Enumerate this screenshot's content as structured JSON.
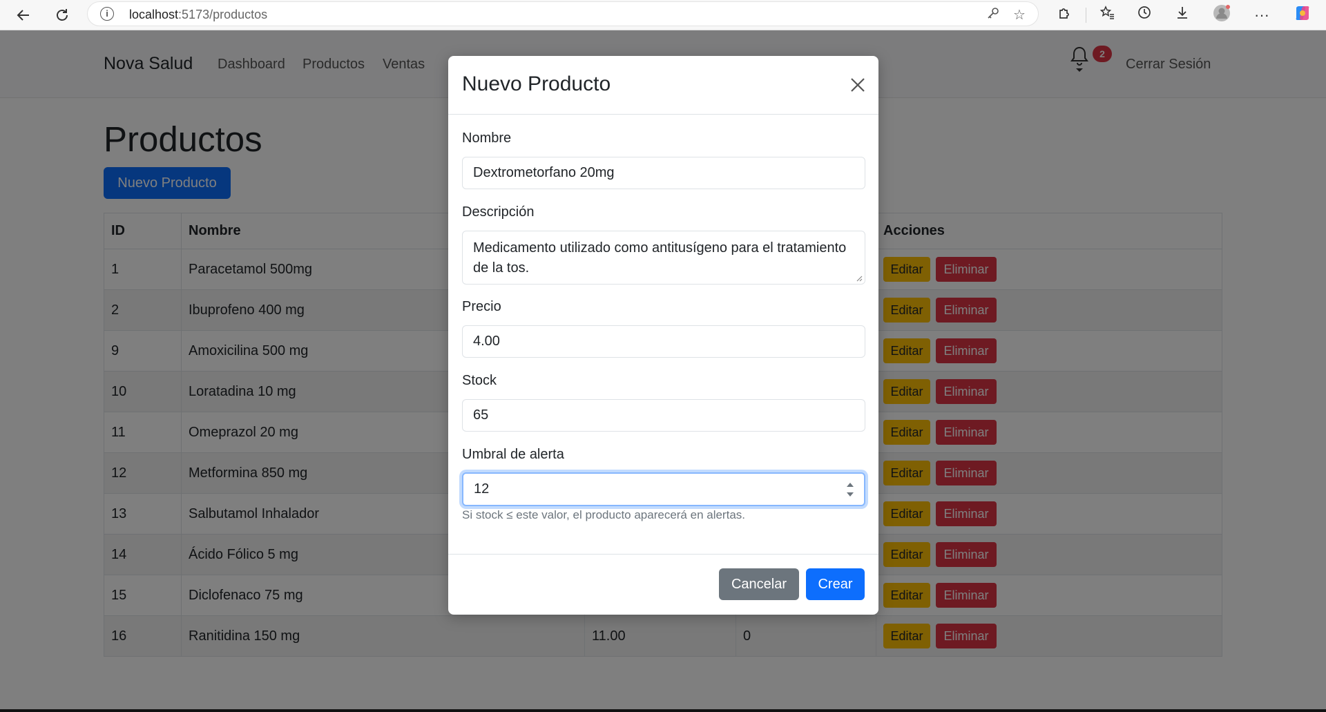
{
  "browser": {
    "url_host": "localhost",
    "url_path": ":5173/productos"
  },
  "navbar": {
    "brand": "Nova Salud",
    "links": [
      "Dashboard",
      "Productos",
      "Ventas"
    ],
    "notifications_count": "2",
    "logout": "Cerrar Sesión"
  },
  "page": {
    "title": "Productos",
    "new_button": "Nuevo Producto"
  },
  "table": {
    "headers": [
      "ID",
      "Nombre",
      "",
      "",
      "Acciones"
    ],
    "edit_label": "Editar",
    "delete_label": "Eliminar",
    "rows": [
      {
        "id": "1",
        "name": "Paracetamol 500mg",
        "price": "",
        "stock": ""
      },
      {
        "id": "2",
        "name": "Ibuprofeno 400 mg",
        "price": "",
        "stock": ""
      },
      {
        "id": "9",
        "name": "Amoxicilina 500 mg",
        "price": "",
        "stock": ""
      },
      {
        "id": "10",
        "name": "Loratadina 10 mg",
        "price": "",
        "stock": ""
      },
      {
        "id": "11",
        "name": "Omeprazol 20 mg",
        "price": "",
        "stock": ""
      },
      {
        "id": "12",
        "name": "Metformina 850 mg",
        "price": "",
        "stock": ""
      },
      {
        "id": "13",
        "name": "Salbutamol Inhalador",
        "price": "",
        "stock": ""
      },
      {
        "id": "14",
        "name": "Ácido Fólico 5 mg",
        "price": "",
        "stock": ""
      },
      {
        "id": "15",
        "name": "Diclofenaco 75 mg",
        "price": "",
        "stock": ""
      },
      {
        "id": "16",
        "name": "Ranitidina 150 mg",
        "price": "11.00",
        "stock": "0"
      }
    ]
  },
  "modal": {
    "title": "Nuevo Producto",
    "fields": {
      "nombre": {
        "label": "Nombre",
        "value": "Dextrometorfano 20mg"
      },
      "descripcion": {
        "label": "Descripción",
        "value": "Medicamento utilizado como antitusígeno para el tratamiento de la tos."
      },
      "precio": {
        "label": "Precio",
        "value": "4.00"
      },
      "stock": {
        "label": "Stock",
        "value": "65"
      },
      "umbral": {
        "label": "Umbral de alerta",
        "value": "12",
        "help": "Si stock ≤ este valor, el producto aparecerá en alertas."
      }
    },
    "cancel_label": "Cancelar",
    "create_label": "Crear"
  },
  "colors": {
    "primary": "#0d6efd",
    "secondary": "#6c757d",
    "warning": "#ffc107",
    "danger": "#dc3545"
  }
}
